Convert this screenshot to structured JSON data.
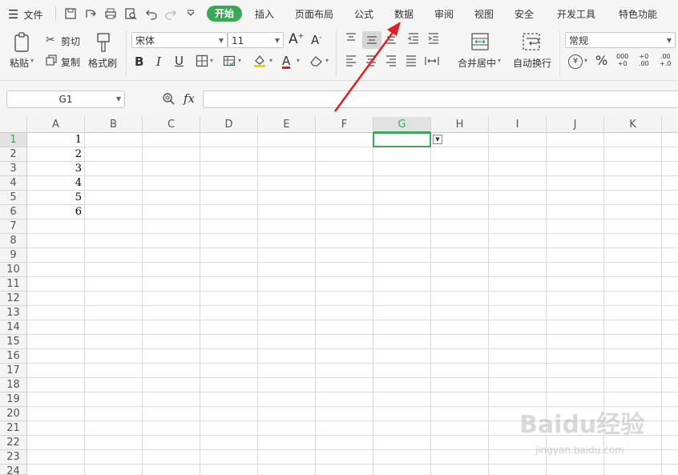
{
  "menubar": {
    "file_label": "文件",
    "tabs": [
      "开始",
      "插入",
      "页面布局",
      "公式",
      "数据",
      "审阅",
      "视图",
      "安全",
      "开发工具",
      "特色功能"
    ]
  },
  "ribbon": {
    "paste_label": "粘贴",
    "cut_label": "剪切",
    "copy_label": "复制",
    "format_painter_label": "格式刷",
    "font_name": "宋体",
    "font_size": "11",
    "bold": "B",
    "italic": "I",
    "underline": "U",
    "font_color_letter": "A",
    "merge_center_label": "合并居中",
    "wrap_text_label": "自动换行",
    "number_format": "常规",
    "percent": "%",
    "thousands": "000",
    "thousands_sub": "+0",
    "inc_decimal": "+0",
    "inc_decimal_sub": ".00",
    "dec_decimal": ".00",
    "dec_decimal_sub": "+.0"
  },
  "formula_bar": {
    "name_box": "G1",
    "fx_label": "fx",
    "formula": ""
  },
  "sheet": {
    "columns": [
      "A",
      "B",
      "C",
      "D",
      "E",
      "F",
      "G",
      "H",
      "I",
      "J",
      "K"
    ],
    "rows": [
      "1",
      "2",
      "3",
      "4",
      "5",
      "6",
      "7",
      "8",
      "9",
      "10",
      "11",
      "12",
      "13",
      "14",
      "15",
      "16",
      "17",
      "18",
      "19",
      "20",
      "21",
      "22",
      "23",
      "24"
    ],
    "column_a_values": [
      "1",
      "2",
      "3",
      "4",
      "5",
      "6"
    ],
    "selected_cell": "G1"
  },
  "watermark": {
    "brand": "Baidu经验",
    "url": "jingyan.baidu.com"
  },
  "colors": {
    "accent": "#3aa856",
    "annotation_arrow": "#e02020"
  }
}
